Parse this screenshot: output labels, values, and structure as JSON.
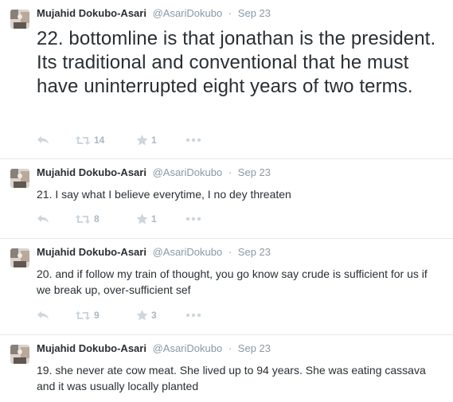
{
  "tweets": [
    {
      "fullname": "Mujahid Dokubo-Asari",
      "username": "@AsariDokubo",
      "separator": "·",
      "time": "Sep 23",
      "text": "22. bottomline is that jonathan is the president. Its traditional and conventional that he must have uninterrupted eight years of two terms.",
      "retweets": "14",
      "favorites": "1"
    },
    {
      "fullname": "Mujahid Dokubo-Asari",
      "username": "@AsariDokubo",
      "separator": "·",
      "time": "Sep 23",
      "text": "21. I say what I believe everytime, I no dey threaten",
      "retweets": "8",
      "favorites": "1"
    },
    {
      "fullname": "Mujahid Dokubo-Asari",
      "username": "@AsariDokubo",
      "separator": "·",
      "time": "Sep 23",
      "text": "20. and if follow my train of thought,  you go know say crude is sufficient for us if we break up, over-sufficient sef",
      "retweets": "9",
      "favorites": "3"
    },
    {
      "fullname": "Mujahid Dokubo-Asari",
      "username": "@AsariDokubo",
      "separator": "·",
      "time": "Sep 23",
      "text": "19. she never ate cow meat. She lived up to 94 years. She was eating cassava and it was usually locally planted"
    }
  ],
  "icons": {
    "reply": "reply-icon",
    "retweet": "retweet-icon",
    "favorite": "star-icon",
    "more": "more-icon"
  },
  "colors": {
    "text": "#292f33",
    "meta": "#8899a6",
    "icon": "#ccd6dd",
    "divider": "#e1e8ed"
  }
}
